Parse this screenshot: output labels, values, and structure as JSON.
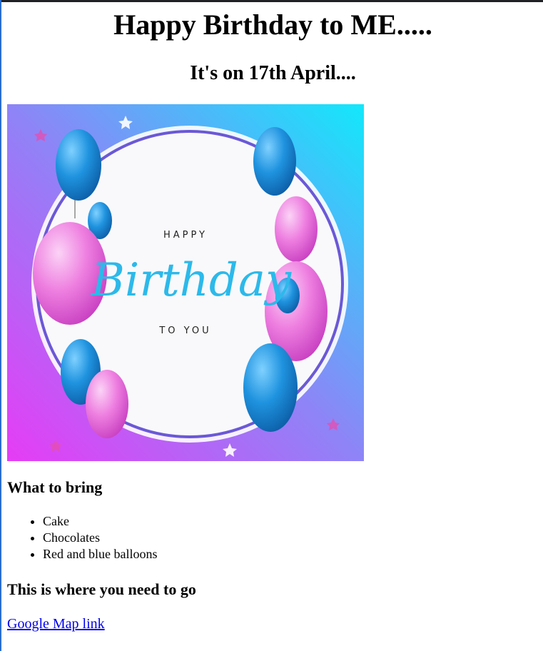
{
  "page": {
    "title": "Happy Birthday to ME.....",
    "subtitle": "It's on 17th April...."
  },
  "hero_image": {
    "alt": "Happy Birthday to you balloon card",
    "text_top": "HAPPY",
    "text_script": "Birthday",
    "text_bottom": "TO YOU",
    "colors": {
      "gradient_left": "#e63cf5",
      "gradient_mid": "#8e84f7",
      "gradient_right": "#12e8fb",
      "blue_balloon": "#1f93df",
      "pink_balloon": "#ee7fe0",
      "script_text": "#2cb9ea"
    }
  },
  "bring": {
    "heading": "What to bring",
    "items": [
      "Cake",
      "Chocolates",
      "Red and blue balloons"
    ]
  },
  "location": {
    "heading": "This is where you need to go",
    "link_text": "Google Map link"
  }
}
